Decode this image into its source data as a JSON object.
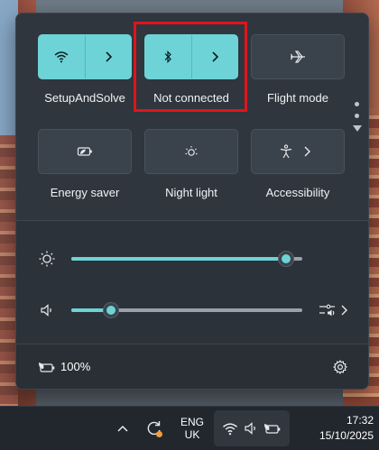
{
  "quick_settings": {
    "tiles": [
      {
        "id": "wifi",
        "label": "SetupAndSolve",
        "active": true,
        "icon": "wifi-icon",
        "has_chevron": true
      },
      {
        "id": "bluetooth",
        "label": "Not connected",
        "active": true,
        "icon": "bluetooth-icon",
        "has_chevron": true
      },
      {
        "id": "flight-mode",
        "label": "Flight mode",
        "active": false,
        "icon": "airplane-icon",
        "has_chevron": false
      },
      {
        "id": "energy-saver",
        "label": "Energy saver",
        "active": false,
        "icon": "energy-saver-icon",
        "has_chevron": false
      },
      {
        "id": "night-light",
        "label": "Night light",
        "active": false,
        "icon": "night-light-icon",
        "has_chevron": false
      },
      {
        "id": "accessibility",
        "label": "Accessibility",
        "active": false,
        "icon": "accessibility-icon",
        "has_chevron": true
      }
    ],
    "brightness": {
      "icon": "brightness-icon",
      "level": 0.93
    },
    "volume": {
      "icon": "speaker-icon",
      "level": 0.17,
      "output_icon": "audio-output-icon"
    },
    "battery": {
      "icon": "battery-saver-icon",
      "text": "100%"
    },
    "settings_icon": "gear-icon"
  },
  "colors": {
    "accent": "#6ed3d6",
    "panel": "#2b3239",
    "highlight": "#e0141c"
  },
  "taskbar": {
    "chevron_icon": "chevron-up-icon",
    "update_icon": "update-icon",
    "language": {
      "line1": "ENG",
      "line2": "UK"
    },
    "tray_icons": [
      "wifi-icon",
      "speaker-icon",
      "battery-saver-icon"
    ],
    "time": "17:32",
    "date": "15/10/2025"
  }
}
